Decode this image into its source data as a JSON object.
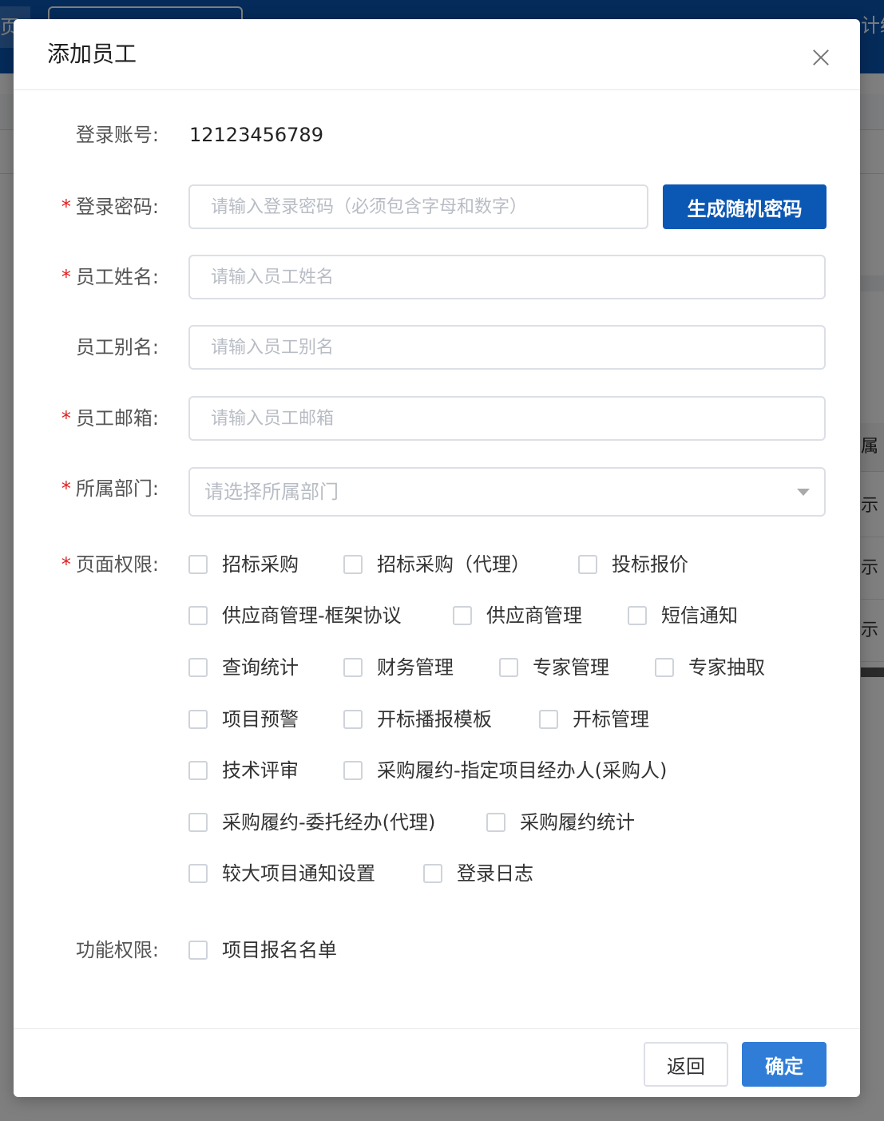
{
  "background": {
    "home_tab": "页",
    "nav_right": "计统计",
    "table_header": "属",
    "row_text": [
      "示",
      "示",
      "示"
    ]
  },
  "modal": {
    "title": "添加员工",
    "close_icon": "close-icon"
  },
  "form": {
    "account": {
      "label": "登录账号:",
      "value": "12123456789"
    },
    "password": {
      "label": "登录密码:",
      "required": "*",
      "placeholder": "请输入登录密码（必须包含字母和数字）",
      "value": "",
      "generate_label": "生成随机密码"
    },
    "name": {
      "label": "员工姓名:",
      "required": "*",
      "placeholder": "请输入员工姓名",
      "value": ""
    },
    "alias": {
      "label": "员工别名:",
      "placeholder": "请输入员工别名",
      "value": ""
    },
    "email": {
      "label": "员工邮箱:",
      "required": "*",
      "placeholder": "请输入员工邮箱",
      "value": ""
    },
    "department": {
      "label": "所属部门:",
      "required": "*",
      "placeholder": "请选择所属部门"
    },
    "page_permissions": {
      "label": "页面权限:",
      "required": "*",
      "items": [
        "招标采购",
        "招标采购（代理）",
        "投标报价",
        "供应商管理-框架协议",
        "供应商管理",
        "短信通知",
        "查询统计",
        "财务管理",
        "专家管理",
        "专家抽取",
        "项目预警",
        "开标播报模板",
        "开标管理",
        "技术评审",
        "采购履约-指定项目经办人(采购人)",
        "采购履约-委托经办(代理)",
        "采购履约统计",
        "较大项目通知设置",
        "登录日志"
      ]
    },
    "function_permissions": {
      "label": "功能权限:",
      "items": [
        "项目报名名单"
      ]
    }
  },
  "footer": {
    "back_label": "返回",
    "confirm_label": "确定"
  },
  "colors": {
    "primary": "#0b57b4",
    "confirm": "#2f7dd6",
    "required": "#e02020",
    "placeholder": "#b8bcc4",
    "border": "#dcdfe6"
  }
}
